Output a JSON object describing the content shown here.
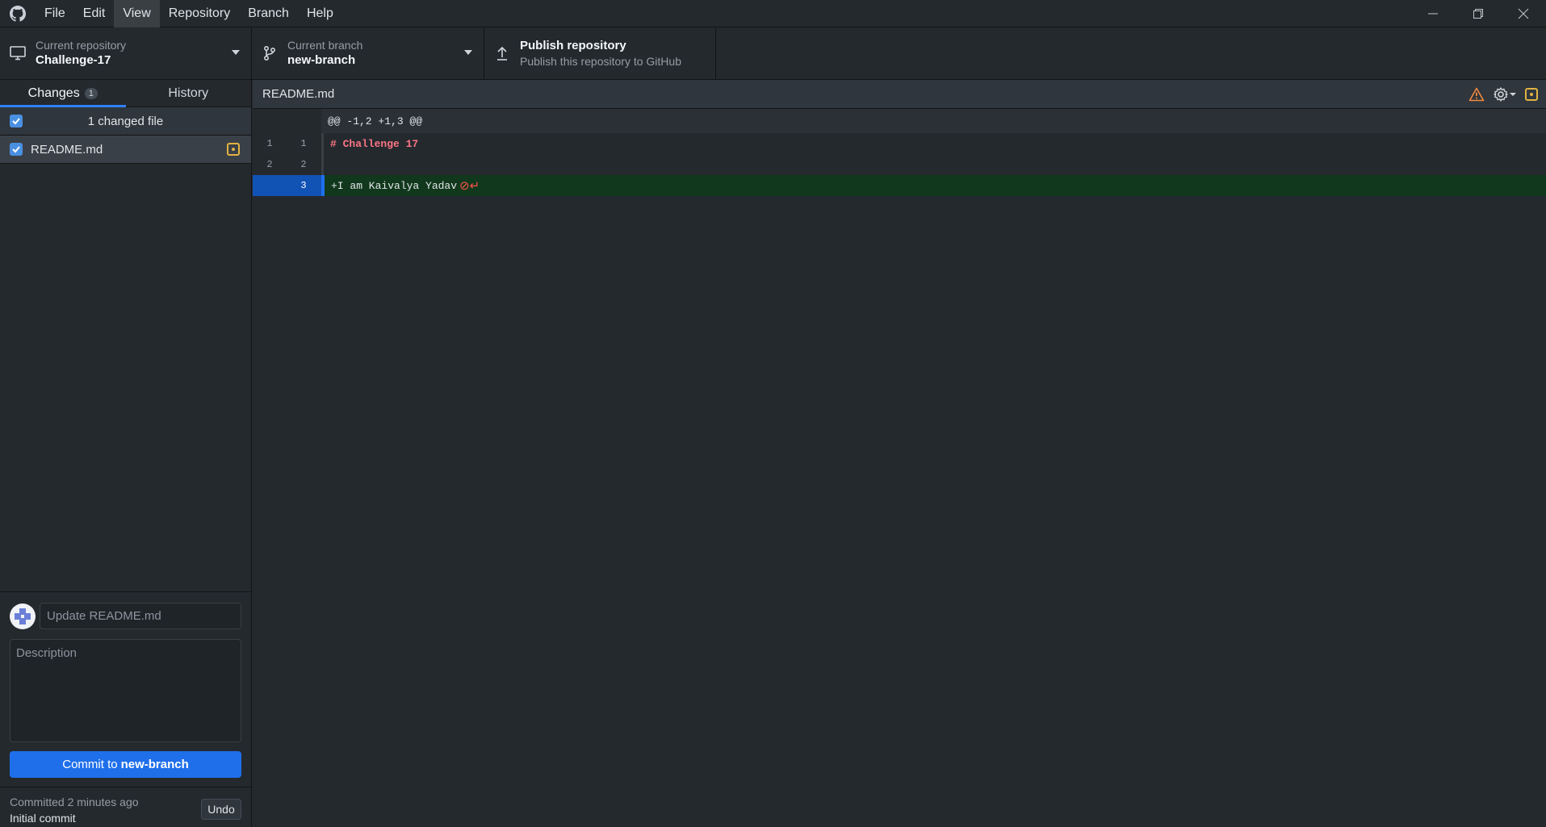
{
  "menu": {
    "items": [
      "File",
      "Edit",
      "View",
      "Repository",
      "Branch",
      "Help"
    ],
    "active": "View"
  },
  "toolbar": {
    "repo_label": "Current repository",
    "repo_value": "Challenge-17",
    "branch_label": "Current branch",
    "branch_value": "new-branch",
    "publish_title": "Publish repository",
    "publish_sub": "Publish this repository to GitHub"
  },
  "sidebar": {
    "tabs": [
      {
        "label": "Changes",
        "count": "1"
      },
      {
        "label": "History"
      }
    ],
    "changed_files_label": "1 changed file",
    "files": [
      {
        "name": "README.md",
        "status": "modified"
      }
    ]
  },
  "commit": {
    "summary_placeholder": "Update README.md",
    "description_placeholder": "Description",
    "button_prefix": "Commit to",
    "button_branch": "new-branch"
  },
  "last_commit": {
    "meta": "Committed 2 minutes ago",
    "title": "Initial commit",
    "undo_label": "Undo"
  },
  "diff": {
    "filename": "README.md",
    "hunk_header": "@@ -1,2 +1,3 @@",
    "lines": [
      {
        "old": "1",
        "new": "1",
        "text": "# Challenge 17",
        "type": "context-heading"
      },
      {
        "old": "2",
        "new": "2",
        "text": "",
        "type": "context"
      },
      {
        "old": "",
        "new": "3",
        "text": "+I am Kaivalya Yadav",
        "type": "added",
        "eol_marker": "⊘↵"
      }
    ]
  },
  "colors": {
    "accent": "#1f6feb",
    "modified": "#e3b341",
    "warning": "#f0883e",
    "added_bg": "#11381c"
  },
  "icons": [
    "github-logo-icon",
    "minimize-icon",
    "restore-icon",
    "close-icon",
    "desktop-icon",
    "branch-icon",
    "upload-icon",
    "warning-icon",
    "gear-icon",
    "modified-icon",
    "checkbox-icon"
  ]
}
